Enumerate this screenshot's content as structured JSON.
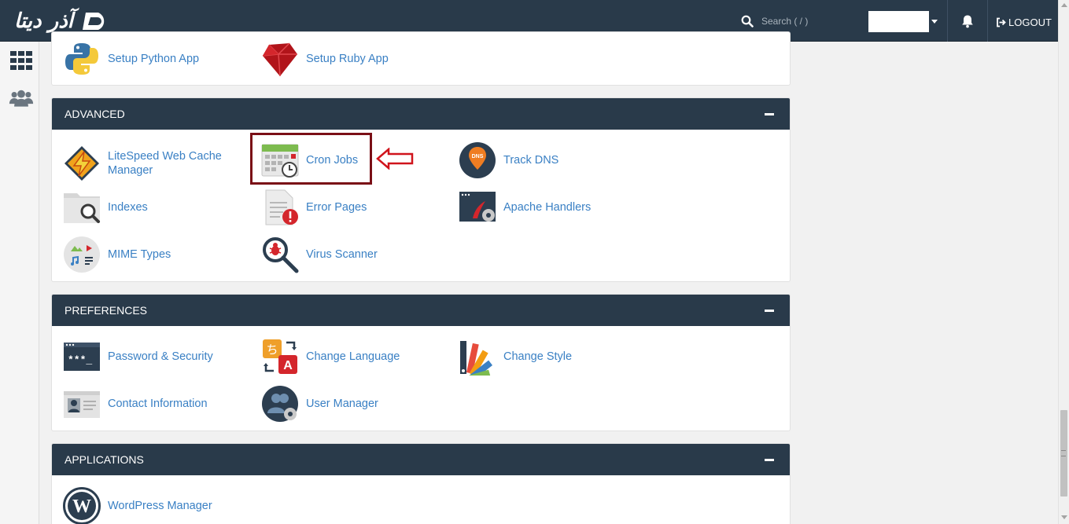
{
  "brand": {
    "logo_text": "آذر دیتا"
  },
  "header": {
    "search_placeholder": "Search ( / )",
    "logout_label": "LOGOUT"
  },
  "panels": {
    "top": {
      "items": [
        {
          "label": "Setup Python App",
          "icon": "python-icon"
        },
        {
          "label": "Setup Ruby App",
          "icon": "ruby-icon"
        }
      ]
    },
    "advanced": {
      "title": "ADVANCED",
      "items": [
        {
          "label": "LiteSpeed Web Cache Manager",
          "icon": "litespeed-icon"
        },
        {
          "label": "Cron Jobs",
          "icon": "calendar-clock-icon"
        },
        {
          "label": "Track DNS",
          "icon": "dns-pin-icon"
        },
        {
          "label": "Indexes",
          "icon": "folder-search-icon"
        },
        {
          "label": "Error Pages",
          "icon": "error-page-icon"
        },
        {
          "label": "Apache Handlers",
          "icon": "apache-handlers-icon"
        },
        {
          "label": "MIME Types",
          "icon": "mime-types-icon"
        },
        {
          "label": "Virus Scanner",
          "icon": "virus-scanner-icon"
        }
      ]
    },
    "preferences": {
      "title": "PREFERENCES",
      "items": [
        {
          "label": "Password & Security",
          "icon": "password-icon"
        },
        {
          "label": "Change Language",
          "icon": "language-icon"
        },
        {
          "label": "Change Style",
          "icon": "palette-icon"
        },
        {
          "label": "Contact Information",
          "icon": "contact-card-icon"
        },
        {
          "label": "User Manager",
          "icon": "user-manager-icon"
        }
      ]
    },
    "applications": {
      "title": "APPLICATIONS",
      "items": [
        {
          "label": "WordPress Manager",
          "icon": "wordpress-icon"
        }
      ]
    }
  },
  "colors": {
    "header_bg": "#293a4a",
    "link": "#3a80c4",
    "highlight": "#7a0f16",
    "arrow": "#d0141c"
  }
}
